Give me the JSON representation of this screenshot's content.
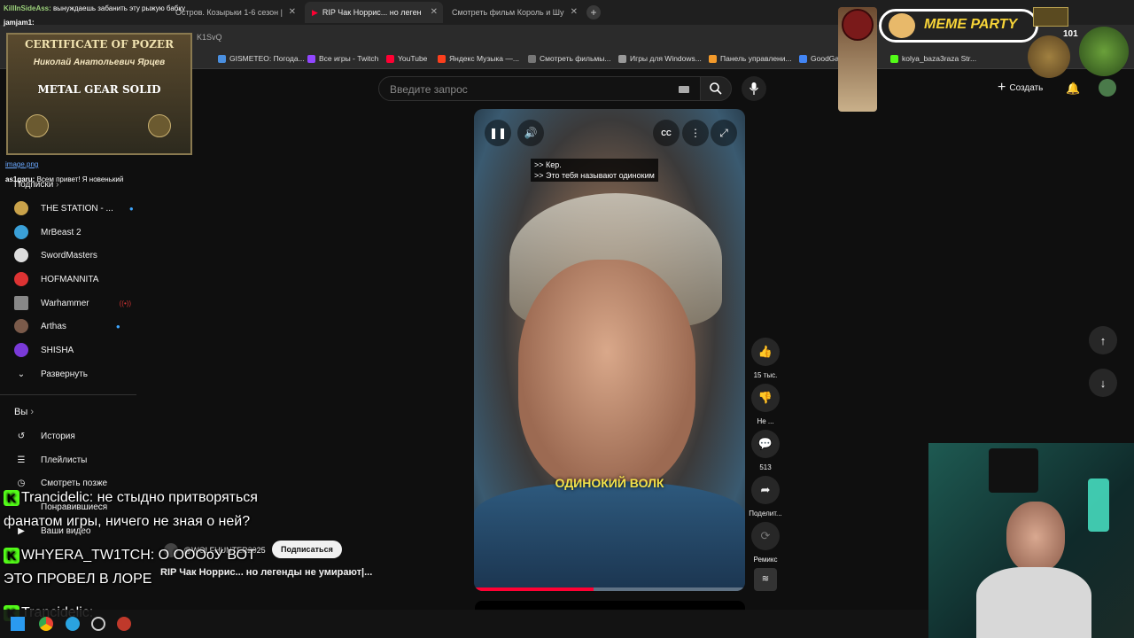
{
  "browser": {
    "tabs": [
      {
        "label": "Остров. Козырьки 1-6 сезон |"
      },
      {
        "label": "RIP Чак Норрис... но леген"
      },
      {
        "label": "Смотреть фильм Король и Шу"
      }
    ],
    "new_tab": "+",
    "url_fragment": "K1SvQ",
    "bookmarks": [
      "GISMETEO: Погода...",
      "Все игры - Twitch",
      "YouTube",
      "Яндекс Музыка —...",
      "Смотреть фильмы...",
      "Игры для Windows...",
      "Панель управлени...",
      "GoodGam",
      "kolya_baza3raza Str..."
    ]
  },
  "youtube": {
    "search_placeholder": "Введите запрос",
    "create_label": "Создать",
    "subscriptions_label": "Подписки",
    "channels": [
      "THE STATION - ...",
      "MrBeast 2",
      "SwordMasters",
      "HOFMANNITA",
      "Warhammer",
      "Arthas",
      "SHISHA",
      "Развернуть"
    ],
    "you_label": "Вы",
    "you_items": [
      "История",
      "Плейлисты",
      "Смотреть позже",
      "Понравившиеся",
      "Ваши видео"
    ],
    "video": {
      "subtitle_1": ">> Кер.",
      "subtitle_2": ">> Это тебя называют одиноким",
      "caption": "ОДИНОКИЙ ВОЛК",
      "progress_fraction": 0.44,
      "channel": "@WOLFHUNTER2025",
      "subscribe_label": "Подписаться",
      "title": "RIP Чак Норрис... но легенды не умирают|..."
    },
    "actions": {
      "likes": "15 тыс.",
      "dislike": "Не ...",
      "comments": "513",
      "share": "Поделит...",
      "remix": "Ремикс"
    }
  },
  "overlay": {
    "chat_top_1_user": "KillInSideAss:",
    "chat_top_1_text": "вынуждаешь забанить эту рыжую бабку",
    "chat_top_2_user": "jamjam1:",
    "cert_title": "CERTIFICATE OF POZER",
    "cert_name": "Николай Анатольевич Ярцев",
    "cert_game": "METAL GEAR SOLID",
    "image_link": "image.png",
    "chat_as1_user": "as1garu:",
    "chat_as1_text": "Всем привет! Я новенький",
    "big_chat_1": "Trancidelic: не стыдно притворяться",
    "big_chat_1b": "фанатом игры, ничего не зная о ней?",
    "big_chat_2": "WHYERA_TW1TCH: О ОООоУ ВОТ",
    "big_chat_2b": "ЭТО ПРОВЕЛ В ЛОРЕ",
    "big_chat_3": "Trancidelic:",
    "meme_party": "MEME PARTY",
    "counter": "101"
  }
}
